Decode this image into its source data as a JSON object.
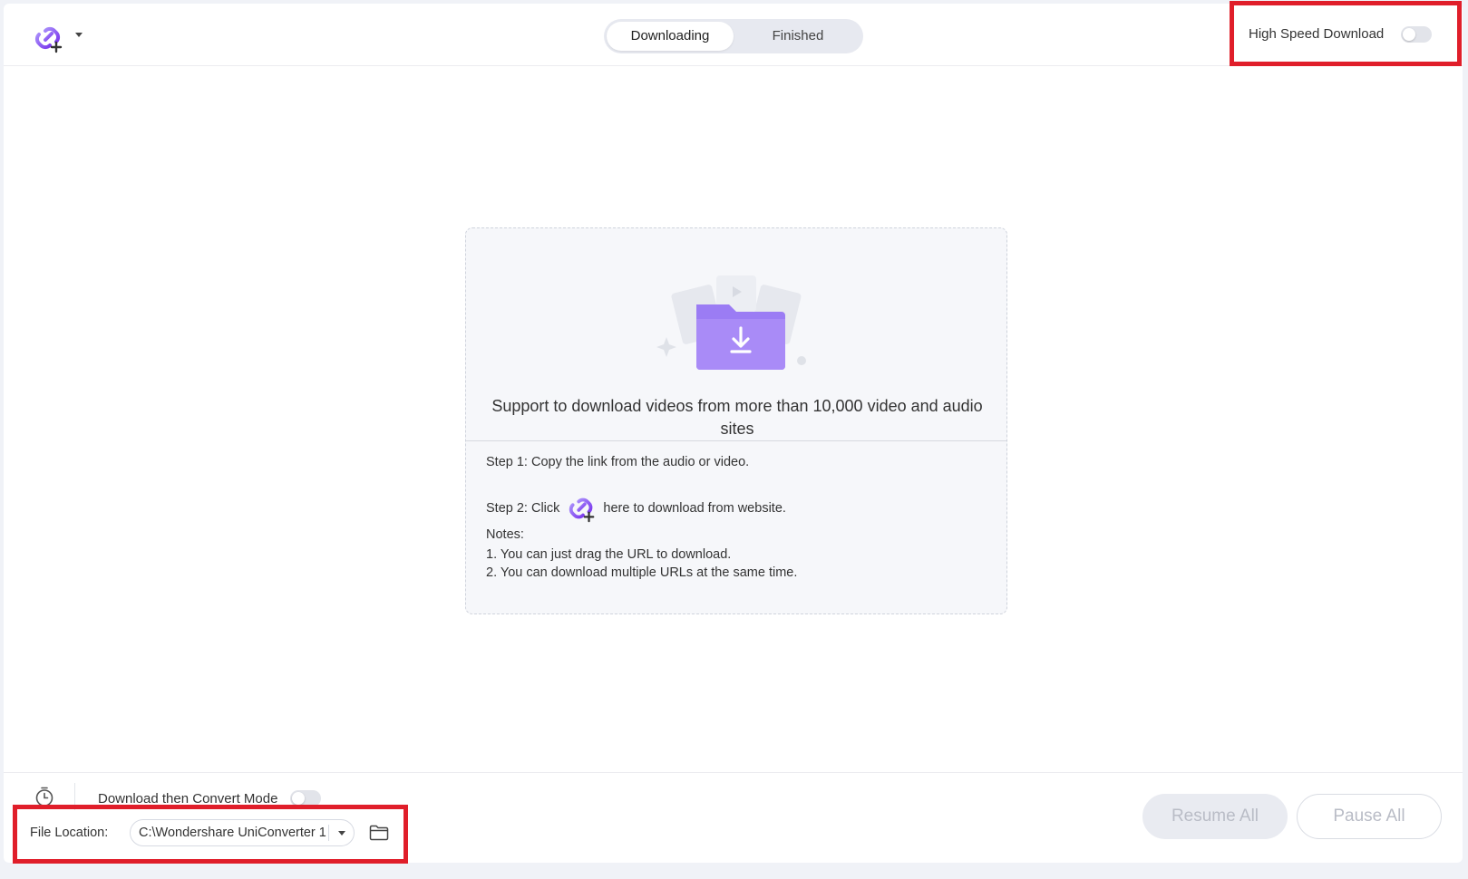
{
  "toolbar": {
    "add_url_icon": "link-add-icon",
    "caret_icon": "chevron-down-icon"
  },
  "tabs": [
    {
      "label": "Downloading",
      "active": true
    },
    {
      "label": "Finished",
      "active": false
    }
  ],
  "high_speed": {
    "label": "High Speed Download",
    "enabled": false
  },
  "dropzone": {
    "title": "Support to download videos from more than 10,000 video and audio sites",
    "step1": "Step 1: Copy the link from the audio or video.",
    "step2_prefix": "Step 2: Click",
    "step2_suffix": "here to download from website.",
    "notes_title": "Notes:",
    "note1": "1. You can just drag the URL to download.",
    "note2": "2. You can download multiple URLs at the same time."
  },
  "bottom": {
    "convert_mode_label": "Download then Convert Mode",
    "convert_mode_enabled": false,
    "file_location_label": "File Location:",
    "file_location_value": "C:\\Wondershare UniConverter 1",
    "resume_all": "Resume All",
    "pause_all": "Pause All"
  },
  "colors": {
    "accent": "#8b5cf6",
    "highlight_box": "#e01e2a"
  }
}
